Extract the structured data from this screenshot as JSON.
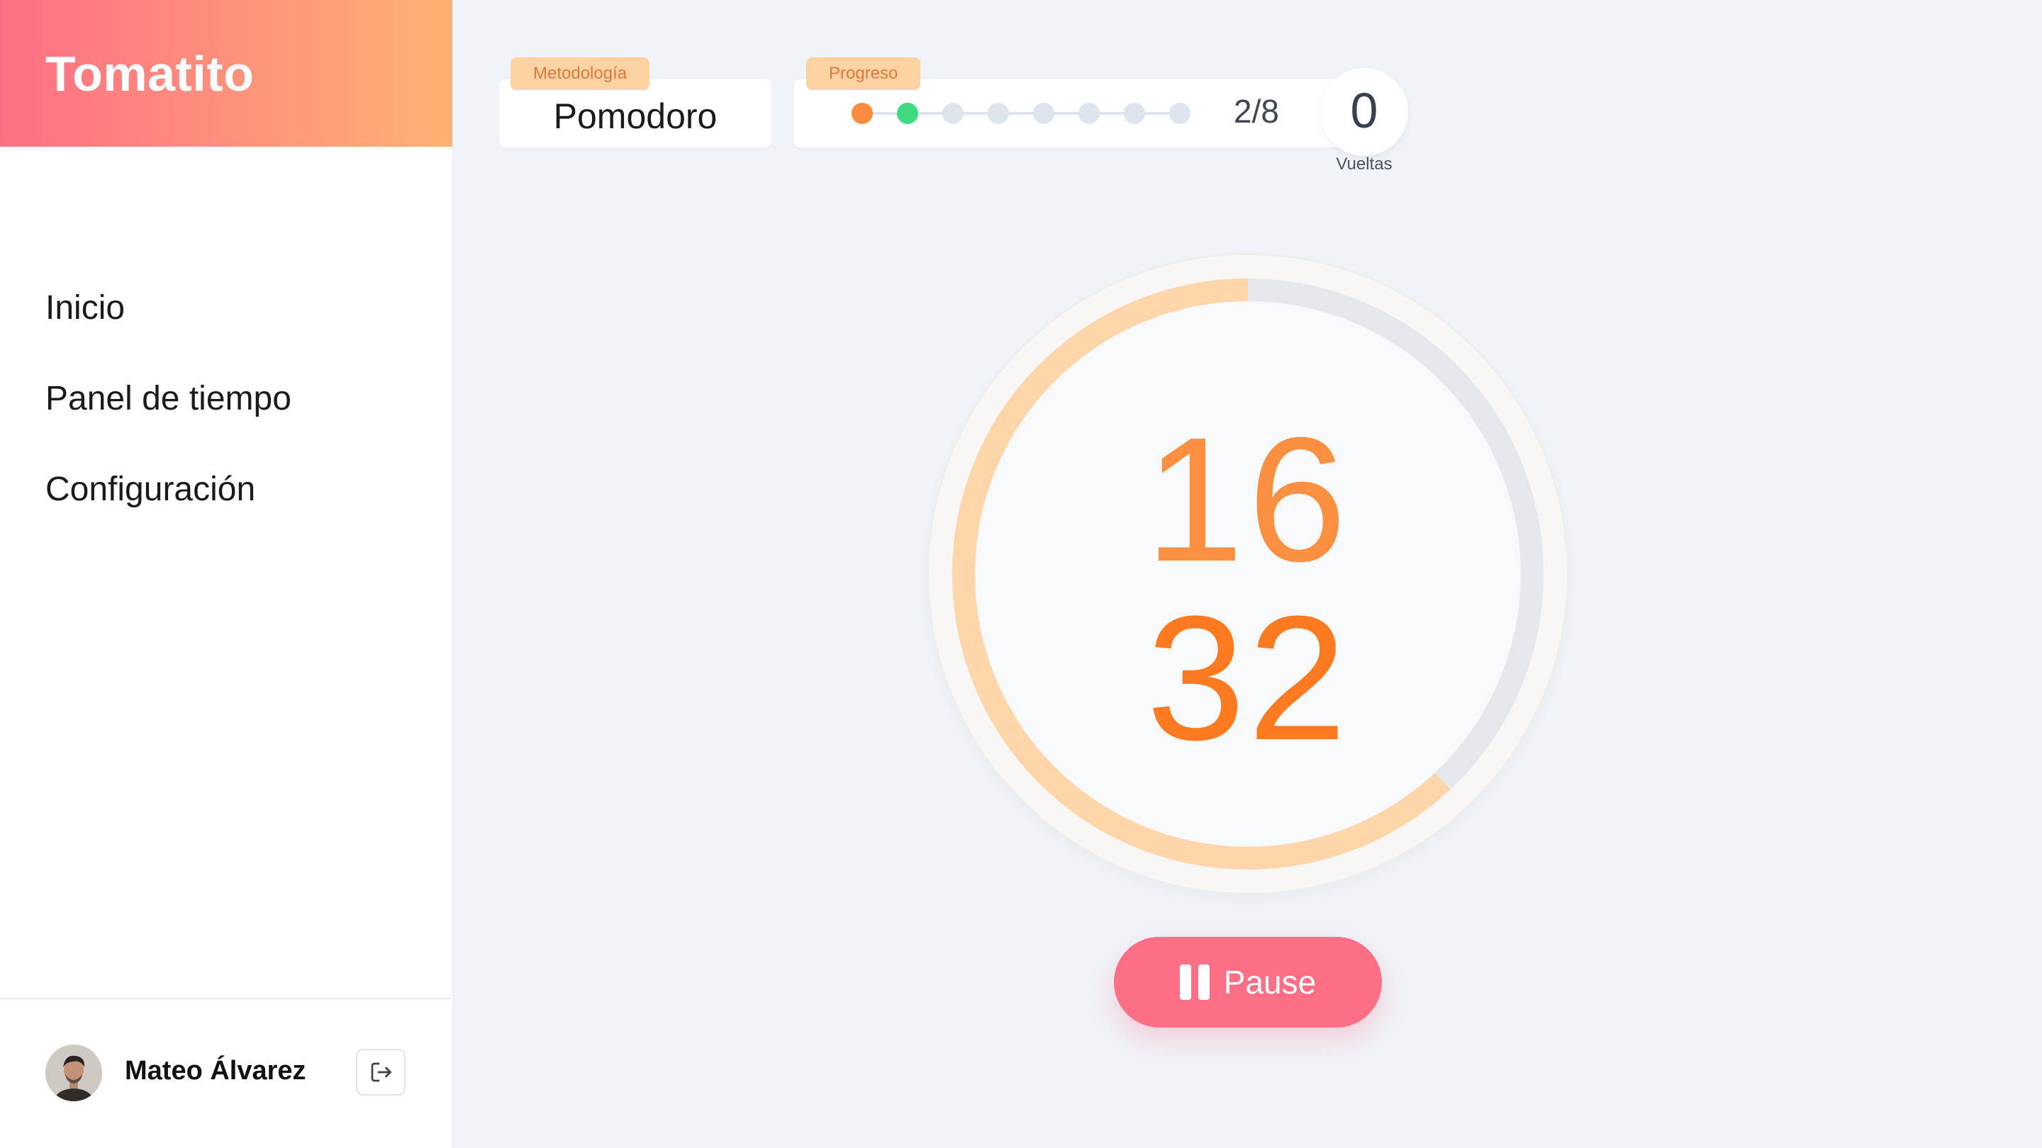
{
  "app": {
    "brand": "Tomatito"
  },
  "sidebar": {
    "items": [
      {
        "label": "Inicio"
      },
      {
        "label": "Panel de tiempo"
      },
      {
        "label": "Configuración"
      }
    ],
    "user": {
      "name": "Mateo Álvarez",
      "logout_icon": "logout-icon"
    }
  },
  "header": {
    "method_tag": "Metodología",
    "method_value": "Pomodoro",
    "progress_tag": "Progreso",
    "progress_count": "2/8",
    "progress_completed": 1,
    "progress_current": 2,
    "progress_total": 8,
    "laps_value": "0",
    "laps_label": "Vueltas"
  },
  "timer": {
    "minutes": "16",
    "seconds": "32",
    "progress_fraction": 0.62
  },
  "controls": {
    "pause_label": "Pause",
    "pause_icon": "pause-icon"
  },
  "colors": {
    "brand_start": "#fd6f85",
    "brand_end": "#feb272",
    "accent": "#fd7a21",
    "done": "#3fd97f",
    "pause_button": "#fd6f85"
  }
}
